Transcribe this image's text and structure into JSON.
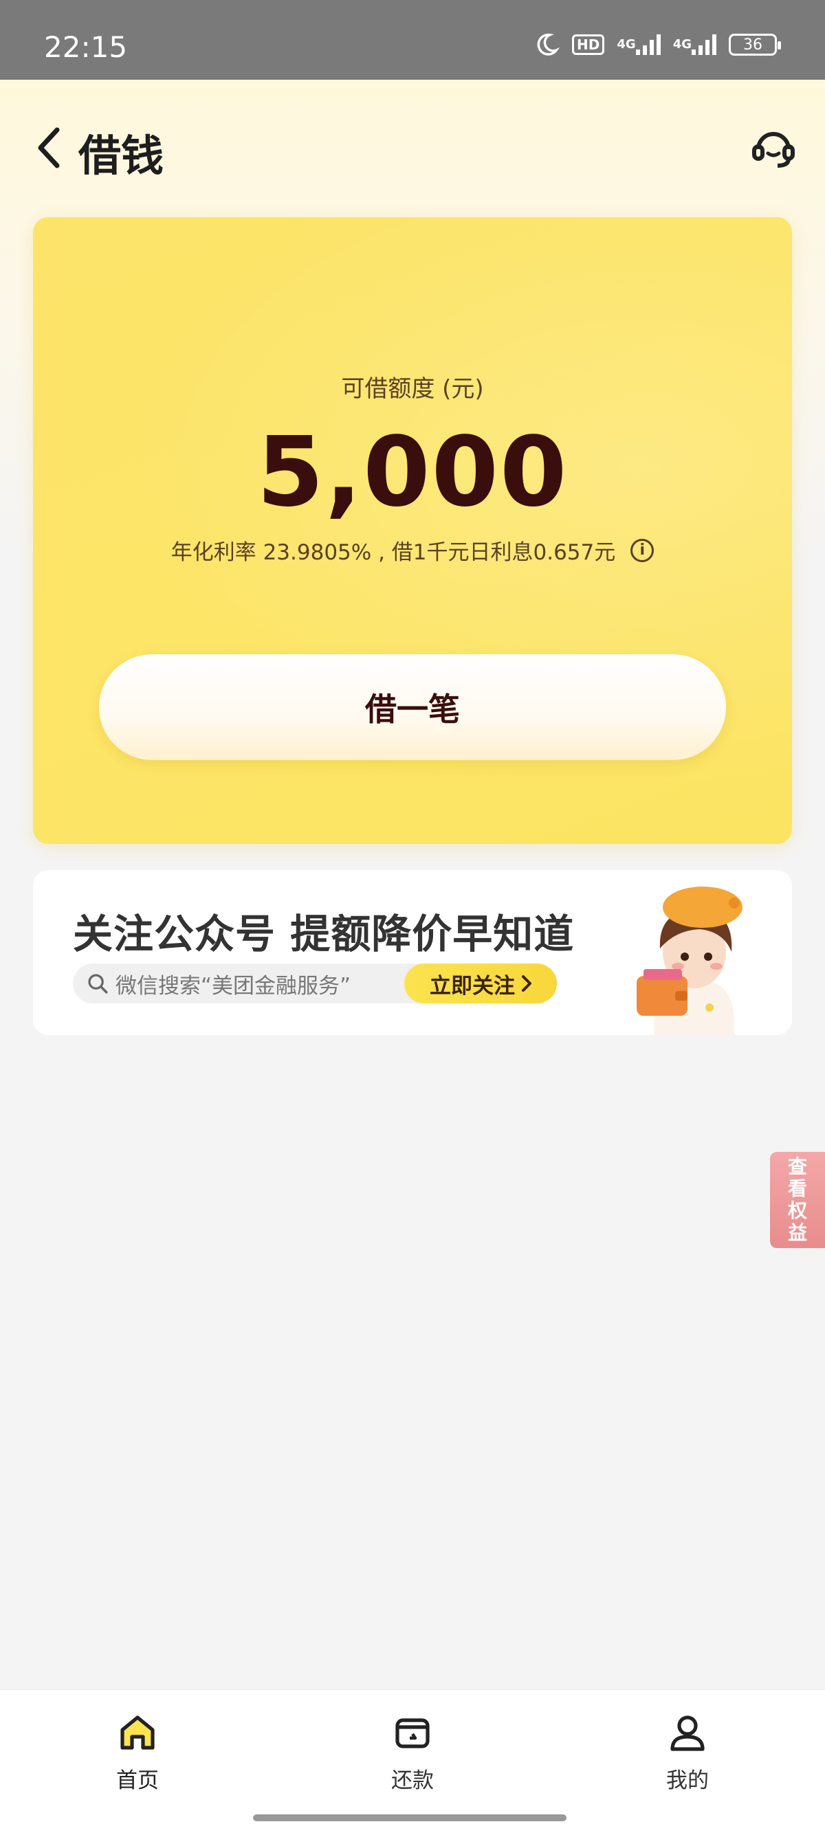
{
  "status_bar": {
    "time": "22:15",
    "hd_label": "HD",
    "net1": "4G",
    "net2": "4G",
    "battery": "36"
  },
  "header": {
    "title": "借钱",
    "back_icon": "chevron-left-icon",
    "service_icon": "headset-icon"
  },
  "credit": {
    "label": "可借额度 (元)",
    "amount": "5,000",
    "rate_text": "年化利率  23.9805% , 借1千元日利息0.657元",
    "info_icon": "info-icon",
    "borrow_label": "借一笔"
  },
  "banner": {
    "title": "关注公众号 提额降价早知道",
    "search_text": "微信搜索“美团金融服务”",
    "follow_label": "立即关注",
    "mascot_icon": "girl-with-wallet-illustration"
  },
  "side_tag": {
    "chars": [
      "查",
      "看",
      "权",
      "益"
    ]
  },
  "bottom_nav": {
    "tabs": [
      {
        "label": "首页",
        "icon": "home-icon"
      },
      {
        "label": "还款",
        "icon": "wallet-icon"
      },
      {
        "label": "我的",
        "icon": "user-icon"
      }
    ]
  },
  "colors": {
    "accent_yellow": "#fde568",
    "amount_color": "#3a0e0c",
    "side_tag": "#e88c8c"
  }
}
